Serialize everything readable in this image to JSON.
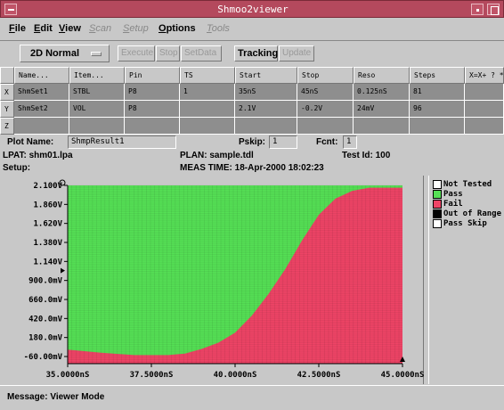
{
  "window": {
    "title": "Shmoo2viewer"
  },
  "menu": {
    "items": [
      {
        "label": "File",
        "enabled": true
      },
      {
        "label": "Edit",
        "enabled": true
      },
      {
        "label": "View",
        "enabled": true
      },
      {
        "label": "Scan",
        "enabled": false
      },
      {
        "label": "Setup",
        "enabled": false
      },
      {
        "label": "Options",
        "enabled": true
      },
      {
        "label": "Tools",
        "enabled": false
      }
    ]
  },
  "toolbar": {
    "mode_value": "2D Normal",
    "buttons": [
      {
        "label": "Execute",
        "enabled": false
      },
      {
        "label": "Stop",
        "enabled": false
      },
      {
        "label": "SetData",
        "enabled": false
      },
      {
        "label": "Tracking",
        "enabled": true
      },
      {
        "label": "Update",
        "enabled": false
      }
    ]
  },
  "table": {
    "columns": [
      "Name...",
      "Item...",
      "Pin",
      "TS",
      "Start",
      "Stop",
      "Reso",
      "Steps",
      "X=X+ ? *Y"
    ],
    "row_labels": [
      "X",
      "Y",
      "Z"
    ],
    "rows": [
      [
        "ShmSet1",
        "STBL",
        "P8",
        "1",
        "35nS",
        "45nS",
        "0.125nS",
        "81",
        ""
      ],
      [
        "ShmSet2",
        "VOL",
        "P8",
        "",
        "2.1V",
        "-0.2V",
        "24mV",
        "96",
        ""
      ],
      [
        "",
        "",
        "",
        "",
        "",
        "",
        "",
        "",
        ""
      ]
    ]
  },
  "info": {
    "plot_name_label": "Plot Name:",
    "plot_name_value": "ShmpResult1",
    "pskip_label": "Pskip:",
    "pskip_value": "1",
    "fcnt_label": "Fcnt:",
    "fcnt_value": "1",
    "lpat": "LPAT: shm01.lpa",
    "plan": "PLAN: sample.tdl",
    "test_id": "Test Id: 100",
    "setup": "Setup:",
    "meas_time": "MEAS TIME: 18-Apr-2000 18:02:23"
  },
  "legend": {
    "items": [
      {
        "label": "Not Tested",
        "color": "#ffffff"
      },
      {
        "label": "Pass",
        "color": "#55e055"
      },
      {
        "label": "Fail",
        "color": "#ee4466"
      },
      {
        "label": "Out of Range",
        "color": "#000000"
      },
      {
        "label": "Pass Skip",
        "color": "#ffffff"
      }
    ]
  },
  "chart_data": {
    "type": "heatmap",
    "x_ticks": [
      "35.0000nS",
      "37.5000nS",
      "40.0000nS",
      "42.5000nS",
      "45.0000nS"
    ],
    "y_ticks": [
      "2.100V",
      "1.860V",
      "1.620V",
      "1.380V",
      "1.140V",
      "900.0mV",
      "660.0mV",
      "420.0mV",
      "180.0mV",
      "-60.00mV"
    ],
    "xlim": [
      35,
      45
    ],
    "ylim": [
      -0.2,
      2.1
    ],
    "x_unit": "nS",
    "y_unit": "V",
    "pass_color": "#55e055",
    "fail_color": "#ee4466",
    "boundary": {
      "x": [
        35.0,
        36.0,
        37.0,
        38.0,
        38.5,
        39.0,
        39.5,
        40.0,
        40.5,
        41.0,
        41.5,
        42.0,
        42.5,
        43.0,
        43.5,
        44.0,
        45.0
      ],
      "v": [
        -0.02,
        -0.06,
        -0.09,
        -0.09,
        -0.07,
        -0.01,
        0.07,
        0.2,
        0.42,
        0.7,
        1.02,
        1.39,
        1.72,
        1.93,
        2.03,
        2.07,
        2.07
      ]
    },
    "fail_below": "boundary",
    "grid": false
  },
  "status": {
    "message": "Message: Viewer Mode"
  }
}
